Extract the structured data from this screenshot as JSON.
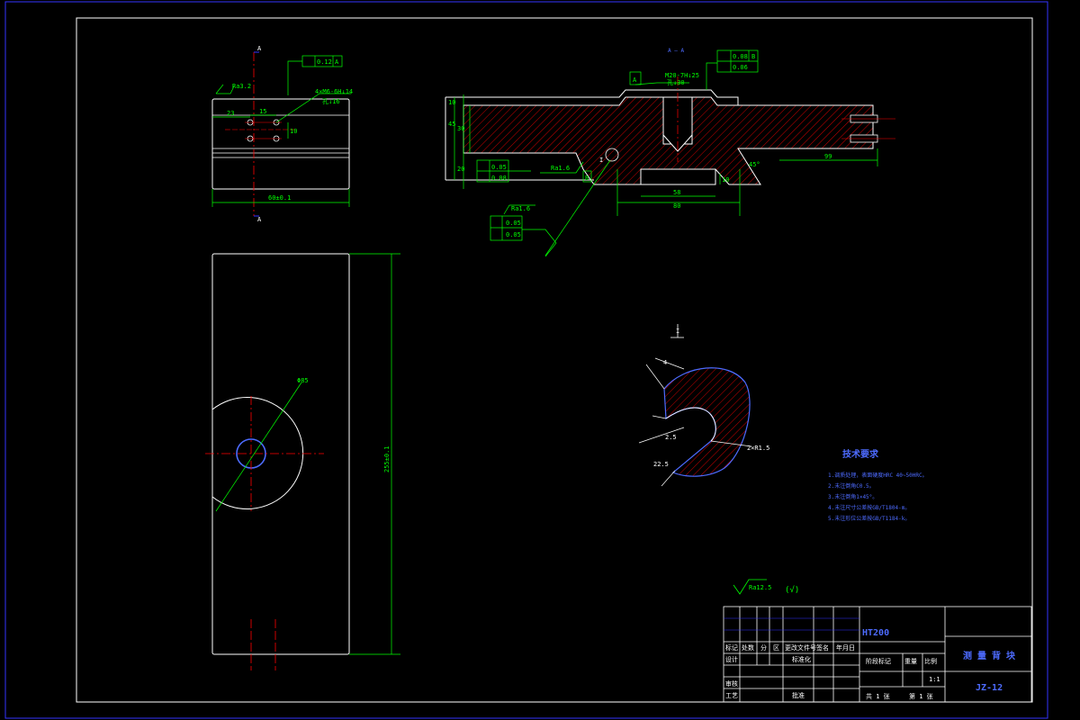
{
  "colors": {
    "background": "#000000",
    "frame": "#3333ff",
    "outline": "#ffffff",
    "dimension": "#00ff00",
    "centerline": "#ff0000",
    "hatch": "#ff0000",
    "notes": "#4d6bff"
  },
  "section_label": "A — A",
  "detail_label": "I",
  "top_view": {
    "surface_finish": "Ra3.2",
    "perpendicularity": "0.12",
    "datum_ref": "A",
    "hole_callout": "4×M6-6H↓14",
    "hole_callout_2": "孔↓16",
    "dim_left": "23",
    "dim_15": "15",
    "dim_10": "10",
    "dim_width": "60±0.1",
    "section_marker": "A"
  },
  "section_view": {
    "thread_callout": "M20-7H↓25",
    "thread_depth": "孔↓30",
    "datum_a": "A",
    "parallel_tol": "0.08",
    "parallel_ref": "B",
    "flatness_tol": "0.06",
    "dim_height_1": "45",
    "dim_height_2": "30",
    "dim_height_3": "20",
    "dim_step": "10",
    "dim_58": "58",
    "dim_80": "80",
    "dim_99": "99",
    "dim_chamfer": "45°",
    "dim_top": "10",
    "straightness": "0.05",
    "flatness_b": "0.08",
    "roughness": "Ra1.6",
    "datum_b": "B"
  },
  "lower_callout": {
    "roughness": "Ra1.6",
    "tol_1": "0.05",
    "tol_2": "0.05"
  },
  "front_view": {
    "diameter": "Φ85",
    "length": "255±0.1"
  },
  "detail_view": {
    "radius": "2×R1.5",
    "dim_a": "4",
    "dim_b": "2.5",
    "dim_c": "22.5"
  },
  "tech_requirements": {
    "title": "技术要求",
    "items": [
      "1.调质处理，表面硬度HRC 40~50HRC。",
      "2.未注倒角C0.5。",
      "3.未注倒角1×45°。",
      "4.未注尺寸公差按GB/T1804-m。",
      "5.未注形位公差按GB/T1184-k。"
    ]
  },
  "general_roughness": {
    "value": "Ra12.5",
    "other": "(√)"
  },
  "title_block": {
    "material": "HT200",
    "drawing_name": "测 量 背 块",
    "drawing_number": "JZ-12",
    "scale": "1:1",
    "sheet_total": "共 1 张",
    "sheet_current": "第 1 张",
    "row_headers": [
      "标记",
      "处数",
      "分",
      "区",
      "更改文件号",
      "签名",
      "年月日"
    ],
    "designer_label": "设计",
    "standard_label": "标准化",
    "review_label": "审核",
    "process_label": "工艺",
    "approve_label": "批准",
    "stage_label": "阶段标记",
    "weight_label": "重量",
    "ratio_label": "比例"
  }
}
